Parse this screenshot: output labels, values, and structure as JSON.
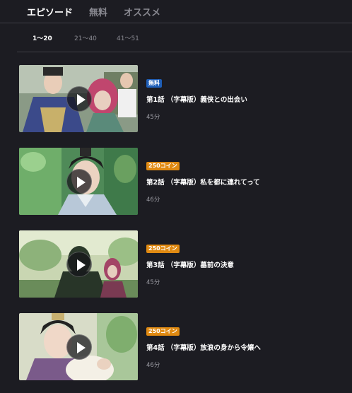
{
  "tabs": [
    {
      "label": "エピソード",
      "active": true
    },
    {
      "label": "無料",
      "active": false
    },
    {
      "label": "オススメ",
      "active": false
    }
  ],
  "ranges": [
    {
      "label": "1〜20",
      "active": true
    },
    {
      "label": "21〜40",
      "active": false
    },
    {
      "label": "41〜51",
      "active": false
    }
  ],
  "colors": {
    "background": "#1c1c22",
    "free_badge": "#1f5fb8",
    "coin_badge": "#e08a12",
    "muted_text": "#8a8a92"
  },
  "episodes": [
    {
      "badge": "無料",
      "badge_type": "free",
      "title": "第1話 （字幕版）義侠との出会い",
      "duration": "45分",
      "thumbnail_icon": "play-icon"
    },
    {
      "badge": "250コイン",
      "badge_type": "coin",
      "title": "第2話 （字幕版）私を都に連れてって",
      "duration": "46分",
      "thumbnail_icon": "play-icon"
    },
    {
      "badge": "250コイン",
      "badge_type": "coin",
      "title": "第3話 （字幕版）墓前の決意",
      "duration": "45分",
      "thumbnail_icon": "play-icon"
    },
    {
      "badge": "250コイン",
      "badge_type": "coin",
      "title": "第4話 （字幕版）放浪の身から令嬢へ",
      "duration": "46分",
      "thumbnail_icon": "play-icon"
    }
  ]
}
